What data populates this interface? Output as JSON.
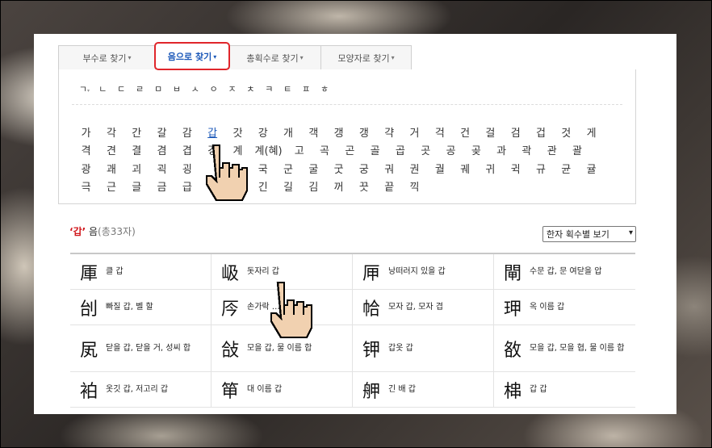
{
  "tabs": [
    {
      "label": "부수로 찾기",
      "active": false
    },
    {
      "label": "음으로 찾기",
      "active": true
    },
    {
      "label": "총획수로 찾기",
      "active": false
    },
    {
      "label": "모양자로 찾기",
      "active": false
    }
  ],
  "caret": "▾",
  "initials": [
    "ㄱ",
    "ㄴ",
    "ㄷ",
    "ㄹ",
    "ㅁ",
    "ㅂ",
    "ㅅ",
    "ㅇ",
    "ㅈ",
    "ㅊ",
    "ㅋ",
    "ㅌ",
    "ㅍ",
    "ㅎ"
  ],
  "initial_marker": "▾",
  "syllable_rows": [
    [
      "가",
      "각",
      "간",
      "갈",
      "감",
      "갑",
      "갓",
      "강",
      "개",
      "객",
      "갱",
      "갱",
      "갹",
      "거",
      "걱",
      "건",
      "걸",
      "검",
      "겁",
      "것",
      "게"
    ],
    [
      "격",
      "견",
      "결",
      "겸",
      "겹",
      "경",
      "계",
      "계(혜)",
      "고",
      "곡",
      "곤",
      "골",
      "곱",
      "곳",
      "공",
      "곶",
      "과",
      "곽",
      "관",
      "괄"
    ],
    [
      "광",
      "괘",
      "괴",
      "괵",
      "굉",
      "",
      "",
      "국",
      "군",
      "굴",
      "굿",
      "궁",
      "궈",
      "권",
      "궐",
      "궤",
      "귀",
      "귁",
      "규",
      "균",
      "귤"
    ],
    [
      "극",
      "근",
      "글",
      "금",
      "급",
      "",
      "",
      "긴",
      "길",
      "김",
      "꺼",
      "끗",
      "끝",
      "끽"
    ]
  ],
  "active_syllable": "갑",
  "result": {
    "quote_open": "‘",
    "syllable": "갑",
    "quote_close": "’",
    "suffix": " 음",
    "count": "(총33자)"
  },
  "sort_select": {
    "value": "한자 획수별 보기",
    "arrow": "▾"
  },
  "results": [
    {
      "hanja": "厙",
      "meaning": "클 갑"
    },
    {
      "hanja": "岋",
      "meaning": "돗자리 갑"
    },
    {
      "hanja": "㕅",
      "meaning": "낭떠러지 있을 갑"
    },
    {
      "hanja": "閘",
      "meaning": "수문 갑, 문 여닫을 압"
    },
    {
      "hanja": "刣",
      "meaning": "빠질 갑, 벨 할"
    },
    {
      "hanja": "㕂",
      "meaning": "손가락 …… 갑"
    },
    {
      "hanja": "帢",
      "meaning": "모자 갑, 모자 겹"
    },
    {
      "hanja": "玾",
      "meaning": "옥 이름 갑"
    },
    {
      "hanja": "㞍",
      "meaning": "닫을 갑, 닫을 거, 성씨 합"
    },
    {
      "hanja": "敆",
      "meaning": "모을 갑, 물 이름 합"
    },
    {
      "hanja": "钾",
      "meaning": "갑옷 갑"
    },
    {
      "hanja": "敋",
      "meaning": "모을 갑, 모을 협, 물 이름 합"
    },
    {
      "hanja": "袙",
      "meaning": "옷깃 갑, 저고리 갑"
    },
    {
      "hanja": "笚",
      "meaning": "대 이름 갑"
    },
    {
      "hanja": "舺",
      "meaning": "긴 배 갑"
    },
    {
      "hanja": "梙",
      "meaning": "갑 갑"
    }
  ]
}
